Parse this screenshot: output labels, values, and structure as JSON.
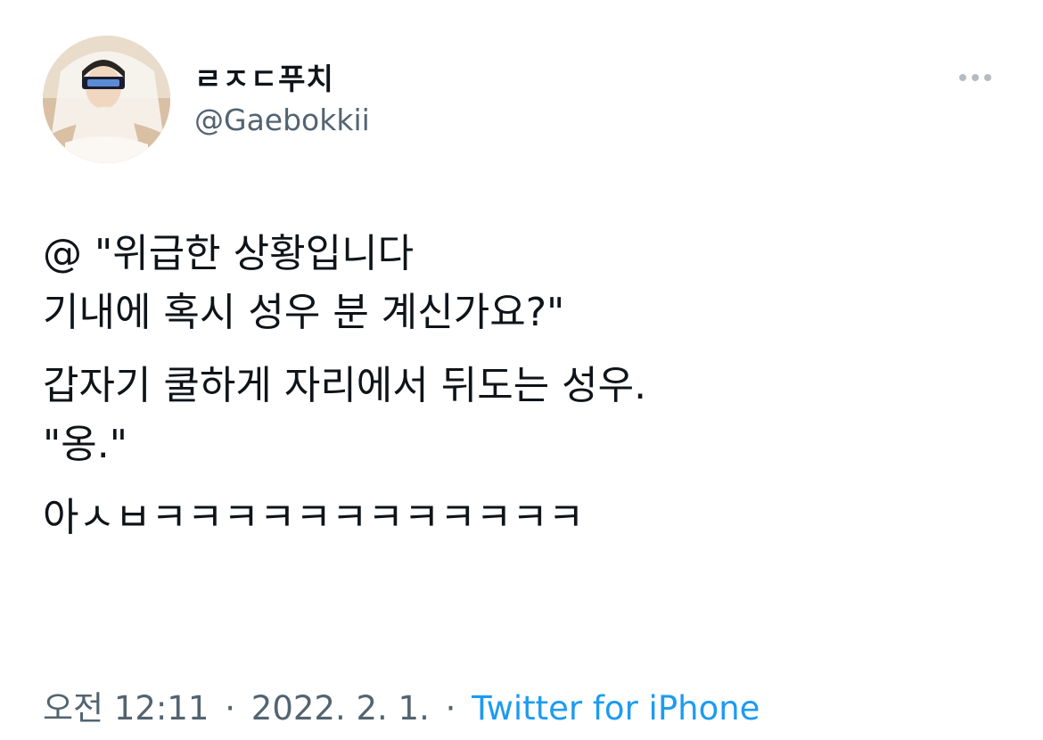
{
  "author": {
    "display_name": "ㄹㅈㄷ푸치",
    "handle": "@Gaebokkii",
    "avatar_icon": "profile-photo"
  },
  "more_icon": "more-horizontal-icon",
  "tweet": {
    "paragraphs": [
      [
        "@ \"위급한 상황입니다",
        "기내에 혹시 성우 분 계신가요?\""
      ],
      [
        "갑자기 쿨하게 자리에서 뒤도는 성우.",
        "\"옹.\""
      ],
      [
        "아ㅅㅂㅋㅋㅋㅋㅋㅋㅋㅋㅋㅋㅋㅋ"
      ]
    ]
  },
  "meta": {
    "time": "오전 12:11",
    "separator": "·",
    "date": "2022. 2. 1.",
    "source": "Twitter for iPhone",
    "source_color": "#1d9bf0"
  }
}
